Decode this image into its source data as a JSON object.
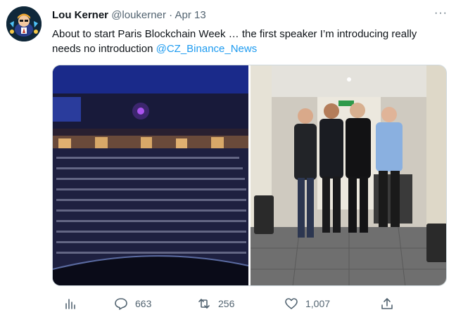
{
  "tweet": {
    "author_name": "Lou Kerner",
    "author_handle": "@loukerner",
    "separator": "·",
    "date": "Apr 13",
    "more_label": "···",
    "text_before": "About to start Paris Blockchain Week … the first speaker I’m introducing really needs no introduction ",
    "mention": "@CZ_Binance_News"
  },
  "actions": {
    "replies": "663",
    "retweets": "256",
    "likes": "1,007"
  },
  "icons": {
    "analytics": "bar-chart-icon",
    "reply": "speech-bubble-icon",
    "retweet": "retweet-arrows-icon",
    "like": "heart-icon",
    "share": "share-upload-icon"
  },
  "colors": {
    "link": "#1d9bf0",
    "secondary_text": "#536471",
    "primary_text": "#0f1419"
  }
}
